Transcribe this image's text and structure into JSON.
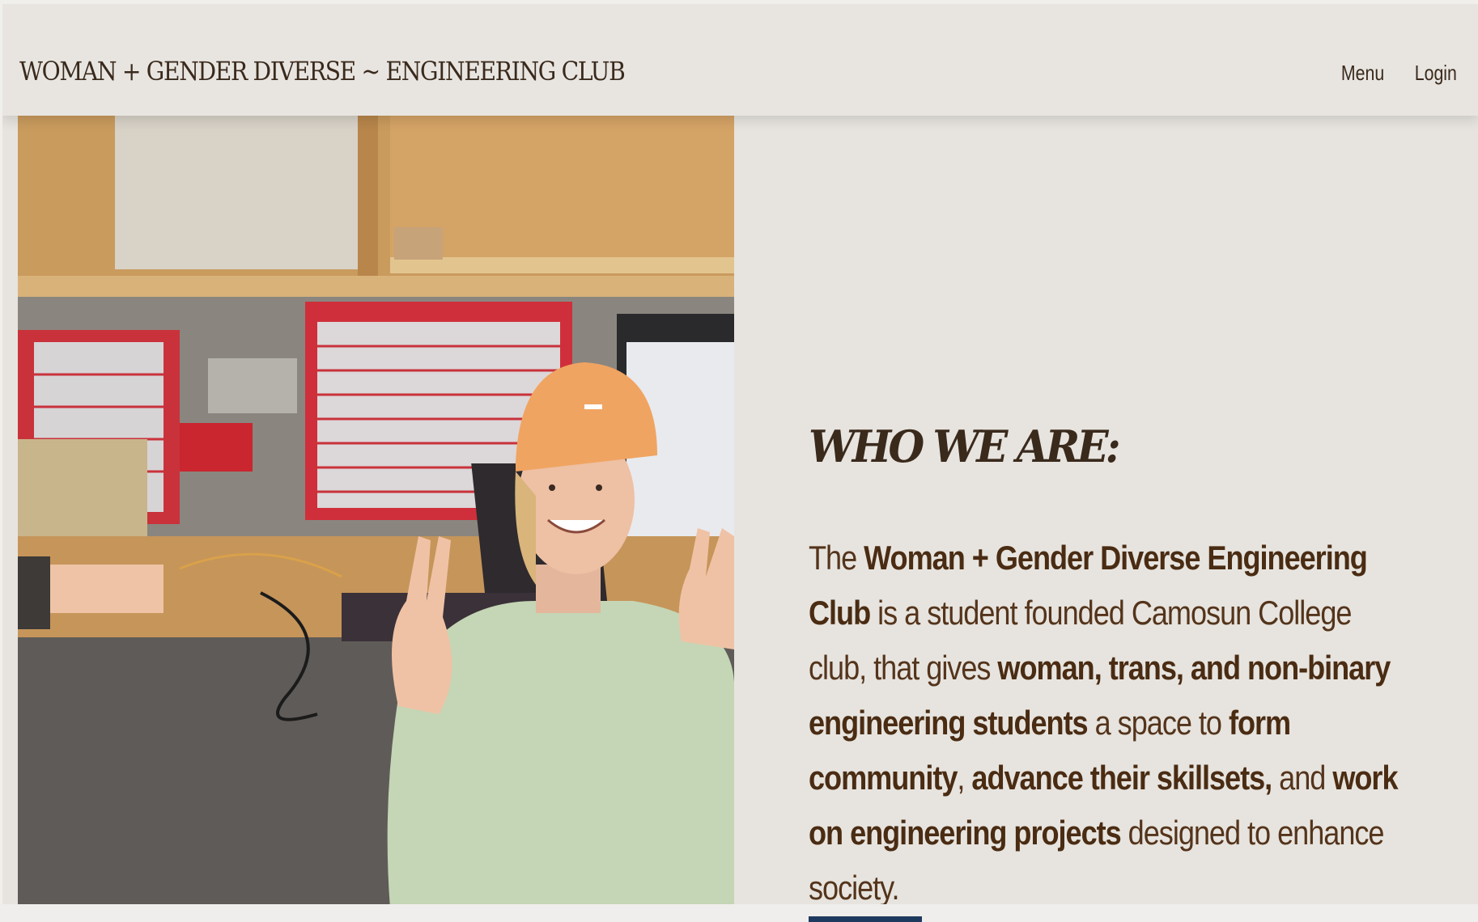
{
  "header": {
    "site_title": "WOMAN + GENDER DIVERSE ~ ENGINEERING CLUB",
    "nav": {
      "menu_label": "Menu",
      "login_label": "Login"
    }
  },
  "main": {
    "heading": "WHO WE ARE:",
    "paragraph": {
      "p1": "The ",
      "b1": "Woman + Gender Diverse Engineering Club",
      "p2": " is a student founded Camosun College club, that gives ",
      "b2": "woman, trans, and non-binary engineering students",
      "p3": " a space to ",
      "b3": "form community",
      "p4": ", ",
      "b4": "advance their skillsets,",
      "p5": " and ",
      "b5": "work on engineering projects",
      "p6": " designed to enhance society."
    }
  },
  "colors": {
    "background": "#e7e4df",
    "text_brown": "#54341b",
    "accent_navy": "#1f3a5f"
  }
}
